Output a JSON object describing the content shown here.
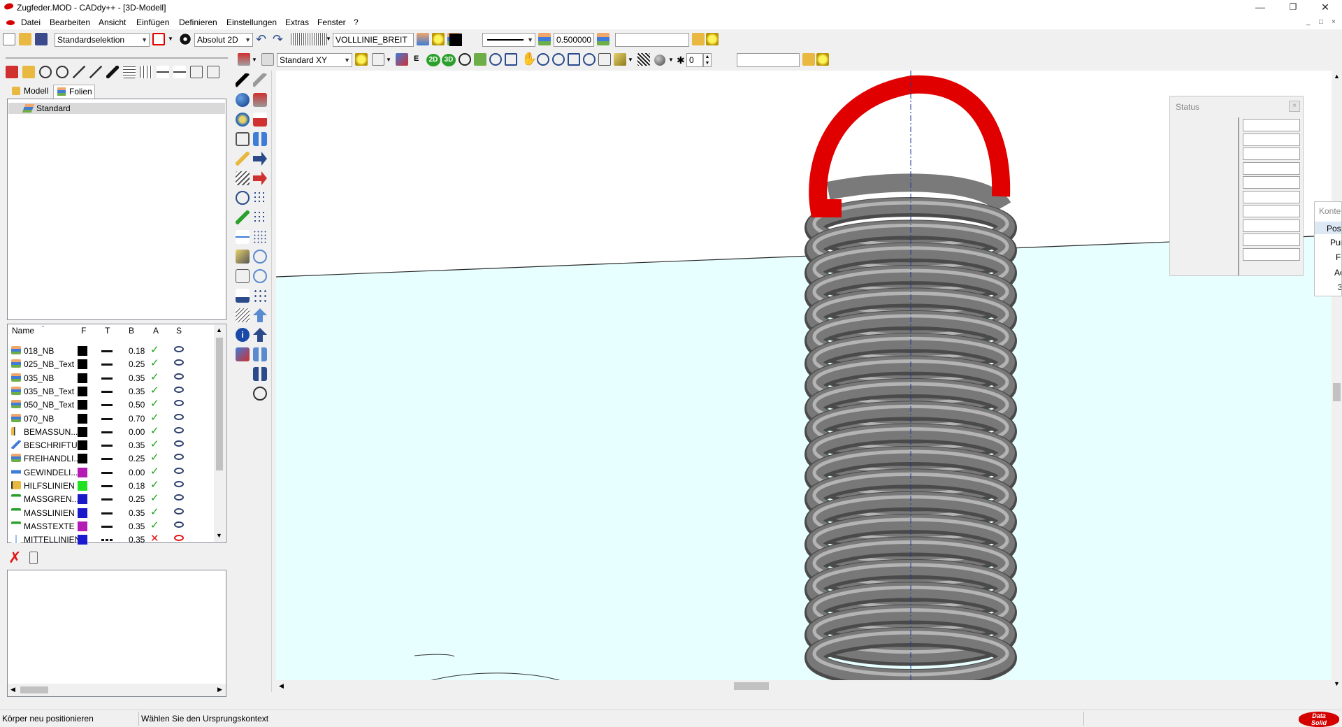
{
  "window": {
    "title": "Zugfeder.MOD - CADdy++ - [3D-Modell]",
    "min_glyph": "—",
    "restore_glyph": "❐",
    "close_glyph": "✕"
  },
  "menu": {
    "items": [
      "Datei",
      "Bearbeiten",
      "Ansicht",
      "Einfügen",
      "Definieren",
      "Einstellungen",
      "Extras",
      "Fenster",
      "?"
    ],
    "mdi_controls": [
      "_",
      "□",
      "×"
    ]
  },
  "toolbar1": {
    "selection_mode": "Standardselektion",
    "coord_mode": "Absolut 2D",
    "line_type": "VOLLLINIE_BREIT",
    "line_width": "0.500000",
    "extra_field": ""
  },
  "toolbar2": {
    "view_plane": "Standard XY",
    "btn_2d": "2D",
    "btn_3d": "3D",
    "btn_e": "E",
    "number_field": "0",
    "extra_field": ""
  },
  "left_panel": {
    "tabs": [
      "Modell",
      "Folien"
    ],
    "active_tab": "Folien",
    "tree": [
      "Standard"
    ]
  },
  "layers": {
    "columns": [
      "Name",
      "F",
      "T",
      "B",
      "A",
      "S"
    ],
    "rows": [
      {
        "name": "018_NB",
        "color": "#000000",
        "ltype": "solid",
        "width": "0.18",
        "active": true,
        "visible": true,
        "icon": "layer-icon"
      },
      {
        "name": "025_NB_Text",
        "color": "#000000",
        "ltype": "solid",
        "width": "0.25",
        "active": true,
        "visible": true,
        "icon": "layer-icon"
      },
      {
        "name": "035_NB",
        "color": "#000000",
        "ltype": "solid",
        "width": "0.35",
        "active": true,
        "visible": true,
        "icon": "layer-icon"
      },
      {
        "name": "035_NB_Text",
        "color": "#000000",
        "ltype": "solid",
        "width": "0.35",
        "active": true,
        "visible": true,
        "icon": "layer-icon"
      },
      {
        "name": "050_NB_Text",
        "color": "#000000",
        "ltype": "solid",
        "width": "0.50",
        "active": true,
        "visible": true,
        "icon": "layer-icon"
      },
      {
        "name": "070_NB",
        "color": "#000000",
        "ltype": "solid",
        "width": "0.70",
        "active": true,
        "visible": true,
        "icon": "layer-icon"
      },
      {
        "name": "BEMASSUN...",
        "color": "#000000",
        "ltype": "solid",
        "width": "0.00",
        "active": true,
        "visible": true,
        "icon": "dimension-icon"
      },
      {
        "name": "BESCHRIFTU...",
        "color": "#000000",
        "ltype": "solid",
        "width": "0.35",
        "active": true,
        "visible": true,
        "icon": "annotation-icon"
      },
      {
        "name": "FREIHANDLI...",
        "color": "#000000",
        "ltype": "solid",
        "width": "0.25",
        "active": true,
        "visible": true,
        "icon": "layer-icon"
      },
      {
        "name": "GEWINDELI...",
        "color": "#b41ab4",
        "ltype": "solid",
        "width": "0.00",
        "active": true,
        "visible": true,
        "icon": "thread-icon"
      },
      {
        "name": "HILFSLINIEN",
        "color": "#22e022",
        "ltype": "solid",
        "width": "0.18",
        "active": true,
        "visible": true,
        "icon": "helpline-icon"
      },
      {
        "name": "MASSGREN...",
        "color": "#1a1ac8",
        "ltype": "solid",
        "width": "0.25",
        "active": true,
        "visible": true,
        "icon": "dimension-limit-icon"
      },
      {
        "name": "MASSLINIEN",
        "color": "#1a1ac8",
        "ltype": "solid",
        "width": "0.35",
        "active": true,
        "visible": true,
        "icon": "dimension-line-icon"
      },
      {
        "name": "MASSTEXTE",
        "color": "#b41ab4",
        "ltype": "solid",
        "width": "0.35",
        "active": true,
        "visible": true,
        "icon": "dimension-text-icon"
      },
      {
        "name": "MITTELLINIEN",
        "color": "#1a1ad0",
        "ltype": "dash",
        "width": "0.35",
        "active": false,
        "visible": false,
        "icon": "centerline-icon"
      }
    ]
  },
  "status": {
    "left": "Körper neu positionieren",
    "right": "Wählen Sie den Ursprungskontext"
  },
  "status_window": {
    "title": "Status",
    "close_glyph": "×"
  },
  "context_panel": {
    "title": "Konte",
    "items": [
      "Posi",
      "Pun",
      "F",
      "Ac",
      "3"
    ]
  },
  "brand": {
    "line1": "Data",
    "line2": "Solid"
  },
  "colors": {
    "spring_body": "#787878",
    "spring_hook": "#e00000",
    "ground_plane": "#e8ffff",
    "accent": "#d40000"
  }
}
